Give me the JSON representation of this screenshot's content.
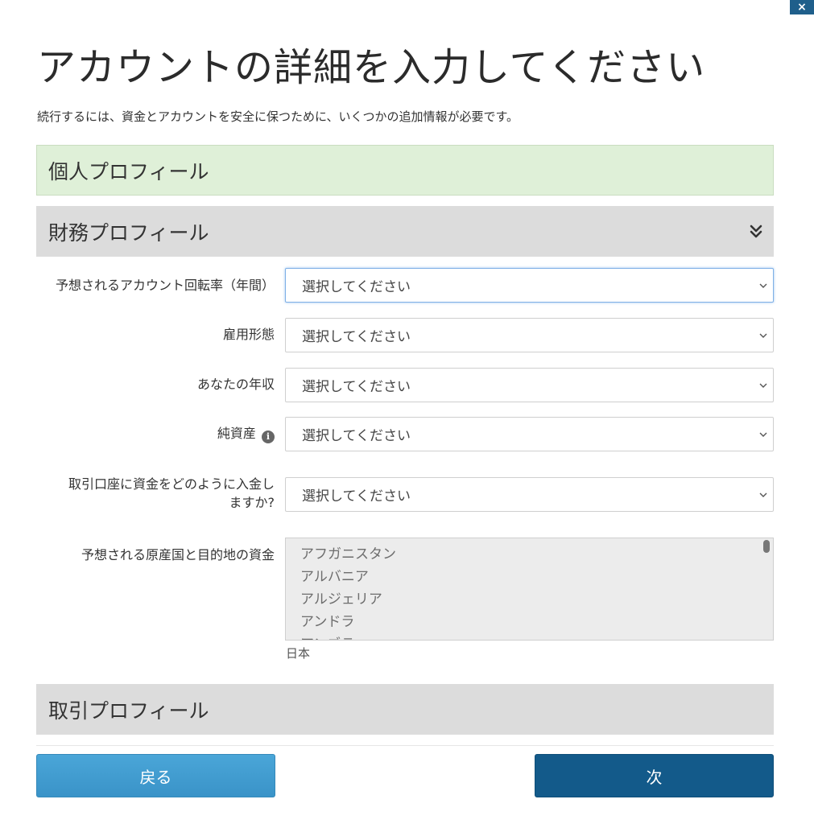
{
  "dialog": {
    "close_label": "×",
    "title": "アカウントの詳細を入力してください",
    "subtitle": "続行するには、資金とアカウントを安全に保つために、いくつかの追加情報が必要です。"
  },
  "sections": {
    "personal": "個人プロフィール",
    "financial": "財務プロフィール",
    "trading": "取引プロフィール"
  },
  "fields": {
    "turnover": {
      "label": "予想されるアカウント回転率（年間）",
      "value": "選択してください"
    },
    "employment": {
      "label": "雇用形態",
      "value": "選択してください"
    },
    "income": {
      "label": "あなたの年収",
      "value": "選択してください"
    },
    "net_worth": {
      "label": "純資産",
      "info": "i",
      "value": "選択してください"
    },
    "funding": {
      "label_line1": "取引口座に資金をどのように入金し",
      "label_line2": "ますか?",
      "value": "選択してください"
    },
    "countries": {
      "label": "予想される原産国と目的地の資金",
      "options": [
        "アフガニスタン",
        "アルバニア",
        "アルジェリア",
        "アンドラ",
        "アンゴラ"
      ],
      "hint": "日本"
    }
  },
  "buttons": {
    "back": "戻る",
    "next": "次"
  },
  "colors": {
    "personal_section_bg": "#dff0d8",
    "section_bg": "#dcdcdc",
    "back_button": "#3a93c8",
    "next_button": "#135a8a",
    "close_button": "#1f5f8b"
  }
}
